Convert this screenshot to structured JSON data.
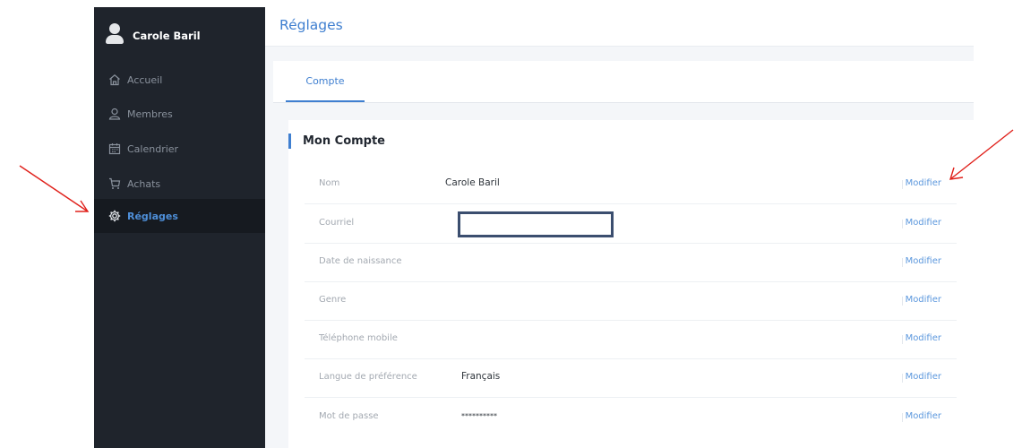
{
  "sidebar": {
    "user_name": "Carole Baril",
    "items": [
      {
        "label": "Accueil",
        "icon": "home-icon"
      },
      {
        "label": "Membres",
        "icon": "user-icon"
      },
      {
        "label": "Calendrier",
        "icon": "calendar-icon"
      },
      {
        "label": "Achats",
        "icon": "cart-icon"
      },
      {
        "label": "Réglages",
        "icon": "gear-icon",
        "active": true
      }
    ]
  },
  "header": {
    "title": "Réglages"
  },
  "tabs": [
    {
      "label": "Compte",
      "active": true
    }
  ],
  "account": {
    "section_title": "Mon Compte",
    "modify_label": "Modifier",
    "rows": [
      {
        "label": "Nom",
        "value": "Carole Baril"
      },
      {
        "label": "Courriel",
        "value": ""
      },
      {
        "label": "Date de naissance",
        "value": ""
      },
      {
        "label": "Genre",
        "value": ""
      },
      {
        "label": "Téléphone mobile",
        "value": ""
      },
      {
        "label": "Langue de préférence",
        "value": "Français"
      },
      {
        "label": "Mot de passe",
        "value": "**********"
      }
    ]
  },
  "colors": {
    "sidebar_bg": "#1f242c",
    "accent": "#3f7fd0",
    "annotation": "#e0201a"
  }
}
